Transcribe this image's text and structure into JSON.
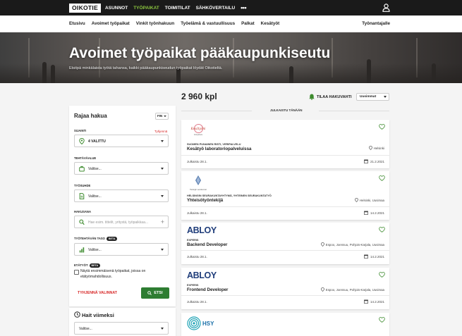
{
  "topnav": {
    "logo": "OIKOTIE",
    "items": [
      {
        "label": "ASUNNOT",
        "active": false
      },
      {
        "label": "TYÖPAIKAT",
        "active": true
      },
      {
        "label": "TOIMITILAT",
        "active": false
      },
      {
        "label": "SÄHKÖVERTAILU",
        "active": false
      }
    ],
    "more": "•••"
  },
  "subnav": {
    "items": [
      "Etusivu",
      "Avoimet työpaikat",
      "Vinkit työnhakuun",
      "Työelämä & vastuullisuus",
      "Palkat",
      "Kesätyöt"
    ],
    "employer": "Työnantajalle"
  },
  "hero": {
    "title": "Avoimet työpaikat pääkaupunkiseutu",
    "subtitle": "Etsitpä minkälaista työtä tahansa, kaikki pääkaupunkiseudun työpaikat löydät Oikotieltä."
  },
  "results": {
    "count": "2 960 kpl",
    "watch_label": "TILAA HAKUVAHTI",
    "sort_value": "Uusimmat",
    "day_label": "JULKAISTU TÄNÄÄN"
  },
  "filters": {
    "title": "Rajaa hakua",
    "lang": "FIN",
    "clear_label": "Tyhjennä",
    "area_label": "SIJAINTI",
    "area_value": "4 VALITTU",
    "task_label": "TEHTÄVÄALUE",
    "task_placeholder": "Valitse...",
    "type_label": "TYÖSUHDE",
    "type_placeholder": "Valitse...",
    "search_label": "HAKUSANA",
    "search_placeholder": "Hae esim. tittelit, yritystä, työpaikkaa...",
    "level_label": "TYÖTEHTÄVÄN TASO",
    "level_placeholder": "Valitse...",
    "remote_label": "ETÄTYÖT",
    "beta": "Beta",
    "remote_text": "Näytä ensimmäisenä työpaikat, joissa on etätyömahdollisuus.",
    "clear_all": "TYHJENNÄ VALINNAT",
    "search_button": "ETSI"
  },
  "recent": {
    "title": "Hait viimeksi",
    "placeholder": "Valitse..."
  },
  "jobs": [
    {
      "company": "SUOMEN PUNAINEN RISTI, VERIPALVELU",
      "title": "Kesätyö laboratoriopalveluissa",
      "location": "Helsinki",
      "published": "Julkaistu 28.1.",
      "due": "21.2.2021",
      "logo": "Kesätyöni",
      "logo_sub": "Veripalvelu"
    },
    {
      "company": "HELSINGIN SEURAKUNTAYHTYMÄ, YHTEINEN SEURAKUNTATYÖ",
      "title": "Yhteisötyöntekijä",
      "location": "Helsinki, Uusimaa",
      "published": "Julkaistu 28.1.",
      "due": "14.2.2021",
      "logo": "Helsingin seurakunnat"
    },
    {
      "company": "EXPERIS",
      "title": "Backend Developer",
      "location": "Espoo, Joensuu, Pohjois-Karjala, Uusimaa",
      "published": "Julkaistu 28.1.",
      "due": "14.2.2021",
      "logo": "ABLOY"
    },
    {
      "company": "EXPERIS",
      "title": "Frontend Developer",
      "location": "Espoo, Joensuu, Pohjois-Karjala, Uusimaa",
      "published": "Julkaistu 28.1.",
      "due": "14.2.2021",
      "logo": "ABLOY"
    },
    {
      "logo": "HSY"
    }
  ]
}
